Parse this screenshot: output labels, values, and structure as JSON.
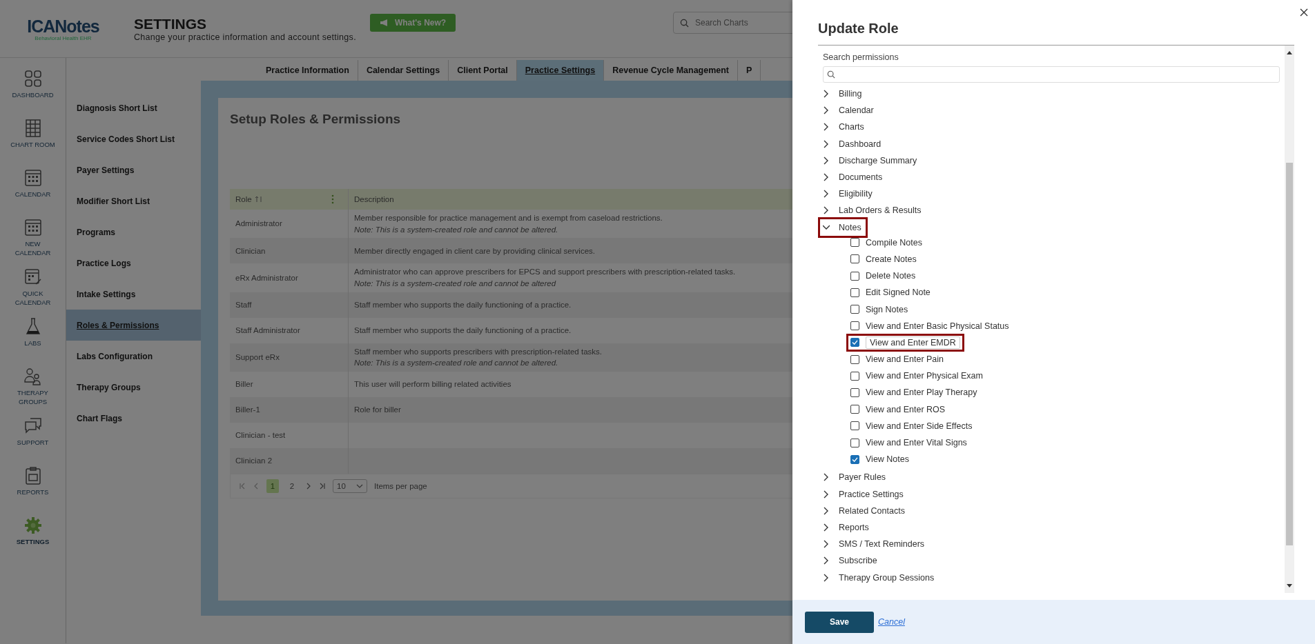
{
  "header": {
    "logo": "ICANotes",
    "logo_tagline": "Behavioral Health EHR",
    "title": "SETTINGS",
    "subtitle": "Change your practice information and account settings.",
    "whats_new_button": "What's New?",
    "search": {
      "placeholder": "Search Charts"
    }
  },
  "nav": [
    {
      "label": "DASHBOARD",
      "kind": "dashboard",
      "selected": false
    },
    {
      "label": "CHART ROOM",
      "kind": "chartroom",
      "selected": false
    },
    {
      "label": "CALENDAR",
      "kind": "calendar",
      "selected": false
    },
    {
      "label": "NEW CALENDAR",
      "kind": "calendar",
      "selected": false
    },
    {
      "label": "QUICK CALENDAR",
      "kind": "quickcalendar",
      "selected": false
    },
    {
      "label": "LABS",
      "kind": "labs",
      "selected": false
    },
    {
      "label": "THERAPY GROUPS",
      "kind": "groups",
      "selected": false
    },
    {
      "label": "SUPPORT",
      "kind": "support",
      "selected": false
    },
    {
      "label": "REPORTS",
      "kind": "reports",
      "selected": false
    },
    {
      "label": "SETTINGS",
      "kind": "settings",
      "selected": true
    }
  ],
  "settings_menu": [
    {
      "label": "Diagnosis Short List",
      "selected": false
    },
    {
      "label": "Service Codes Short List",
      "selected": false
    },
    {
      "label": "Payer Settings",
      "selected": false
    },
    {
      "label": "Modifier Short List",
      "selected": false
    },
    {
      "label": "Programs",
      "selected": false
    },
    {
      "label": "Practice Logs",
      "selected": false
    },
    {
      "label": "Intake Settings",
      "selected": false
    },
    {
      "label": "Roles & Permissions",
      "selected": true
    },
    {
      "label": "Labs Configuration",
      "selected": false
    },
    {
      "label": "Therapy Groups",
      "selected": false
    },
    {
      "label": "Chart Flags",
      "selected": false
    }
  ],
  "tabs": [
    {
      "label": "Practice Information",
      "selected": false
    },
    {
      "label": "Calendar Settings",
      "selected": false
    },
    {
      "label": "Client Portal",
      "selected": false
    },
    {
      "label": "Practice Settings",
      "selected": true
    },
    {
      "label": "Revenue Cycle Management",
      "selected": false
    },
    {
      "label": "P",
      "selected": false
    }
  ],
  "panel": {
    "title": "Setup Roles & Permissions",
    "table": {
      "columns": [
        "Role",
        "Description"
      ],
      "rows": [
        {
          "role": "Administrator",
          "description": "Member responsible for practice management and is exempt from caseload restrictions.",
          "note": "Note: This is a system-created role and cannot be altered."
        },
        {
          "role": "Clinician",
          "description": "Member directly engaged in client care by providing clinical services."
        },
        {
          "role": "eRx Administrator",
          "description": "Administrator who can approve prescribers for EPCS and support prescribers with prescription-related tasks.",
          "note": "Note: This is a system-created role and cannot be altered"
        },
        {
          "role": "Staff",
          "description": "Staff member who supports the daily functioning of a practice."
        },
        {
          "role": "Staff Administrator",
          "description": "Staff member who supports the daily functioning of a practice."
        },
        {
          "role": "Support eRx",
          "description": "Staff member who supports prescribers with prescription-related tasks.",
          "note": "Note: This is a system-created role and cannot be altered."
        },
        {
          "role": "Biller",
          "description": "This user will perform billing related activities"
        },
        {
          "role": "Biller-1",
          "description": "Role for biller"
        },
        {
          "role": "Clinician - test"
        },
        {
          "role": "Clinician 2"
        }
      ]
    },
    "pagination": {
      "pages": [
        {
          "label": "1",
          "selected": true
        },
        {
          "label": "2",
          "selected": false
        }
      ],
      "page_size": "10",
      "page_size_label": "Items per page"
    }
  },
  "drawer": {
    "title": "Update Role",
    "search_label": "Search permissions",
    "permissions": [
      {
        "label": "Billing",
        "expanded": false
      },
      {
        "label": "Calendar",
        "expanded": false
      },
      {
        "label": "Charts",
        "expanded": false
      },
      {
        "label": "Dashboard",
        "expanded": false
      },
      {
        "label": "Discharge Summary",
        "expanded": false
      },
      {
        "label": "Documents",
        "expanded": false
      },
      {
        "label": "Eligibility",
        "expanded": false
      },
      {
        "label": "Lab Orders & Results",
        "expanded": false
      },
      {
        "label": "Notes",
        "expanded": true,
        "highlighted": true,
        "children": [
          {
            "label": "Compile Notes",
            "checked": false,
            "highlighted": false
          },
          {
            "label": "Create Notes",
            "checked": false,
            "highlighted": false
          },
          {
            "label": "Delete Notes",
            "checked": false,
            "highlighted": false
          },
          {
            "label": "Edit Signed Note",
            "checked": false,
            "highlighted": false
          },
          {
            "label": "Sign Notes",
            "checked": false,
            "highlighted": false
          },
          {
            "label": "View and Enter Basic Physical Status",
            "checked": false,
            "highlighted": false
          },
          {
            "label": "View and Enter EMDR",
            "checked": true,
            "highlighted": true
          },
          {
            "label": "View and Enter Pain",
            "checked": false,
            "highlighted": false
          },
          {
            "label": "View and Enter Physical Exam",
            "checked": false,
            "highlighted": false
          },
          {
            "label": "View and Enter Play Therapy",
            "checked": false,
            "highlighted": false
          },
          {
            "label": "View and Enter ROS",
            "checked": false,
            "highlighted": false
          },
          {
            "label": "View and Enter Side Effects",
            "checked": false,
            "highlighted": false
          },
          {
            "label": "View and Enter Vital Signs",
            "checked": false,
            "highlighted": false
          },
          {
            "label": "View Notes",
            "checked": true,
            "highlighted": false
          }
        ]
      },
      {
        "label": "Payer Rules",
        "expanded": false
      },
      {
        "label": "Practice Settings",
        "expanded": false
      },
      {
        "label": "Related Contacts",
        "expanded": false
      },
      {
        "label": "Reports",
        "expanded": false
      },
      {
        "label": "SMS / Text Reminders",
        "expanded": false
      },
      {
        "label": "Subscribe",
        "expanded": false
      },
      {
        "label": "Therapy Group Sessions",
        "expanded": false
      }
    ],
    "save_button": "Save",
    "cancel_link": "Cancel"
  }
}
